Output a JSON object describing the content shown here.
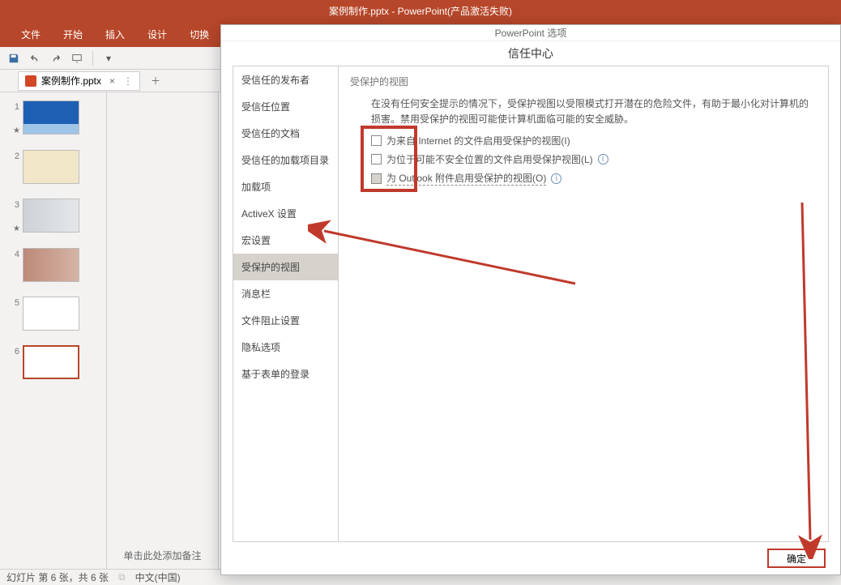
{
  "app": {
    "titlebar": "案例制作.pptx - PowerPoint(产品激活失败)",
    "tabs": [
      "文件",
      "开始",
      "插入",
      "设计",
      "切换"
    ],
    "doc_tab": "案例制作.pptx",
    "notes_placeholder": "单击此处添加备注",
    "status": {
      "slide": "幻灯片 第 6 张，共 6 张",
      "lang": "中文(中国)"
    }
  },
  "thumbs": [
    {
      "n": "1",
      "star": "★"
    },
    {
      "n": "2",
      "star": ""
    },
    {
      "n": "3",
      "star": "★"
    },
    {
      "n": "4",
      "star": ""
    },
    {
      "n": "5",
      "star": ""
    },
    {
      "n": "6",
      "star": ""
    }
  ],
  "dialog": {
    "win_title": "PowerPoint 选项",
    "title": "信任中心",
    "nav": [
      "受信任的发布者",
      "受信任位置",
      "受信任的文档",
      "受信任的加载项目录",
      "加载项",
      "ActiveX 设置",
      "宏设置",
      "受保护的视图",
      "消息栏",
      "文件阻止设置",
      "隐私选项",
      "基于表单的登录"
    ],
    "nav_selected": 7,
    "section_heading": "受保护的视图",
    "desc": "在没有任何安全提示的情况下，受保护视图以受限模式打开潜在的危险文件，有助于最小化对计算机的损害。禁用受保护的视图可能使计算机面临可能的安全威胁。",
    "checks": [
      {
        "label": "为来自 Internet 的文件启用受保护的视图(I)",
        "info": false,
        "gray": false
      },
      {
        "label": "为位于可能不安全位置的文件启用受保护视图(L)",
        "info": true,
        "gray": false
      },
      {
        "label": "为 Outlook 附件启用受保护的视图(O)",
        "info": true,
        "gray": true,
        "dashed": true
      }
    ],
    "ok": "确定"
  }
}
